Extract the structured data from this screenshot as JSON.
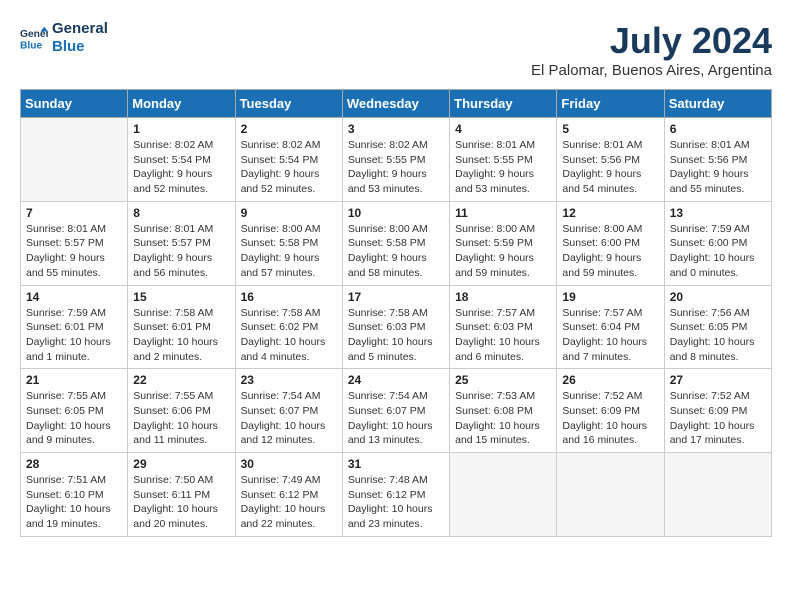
{
  "header": {
    "logo_line1": "General",
    "logo_line2": "Blue",
    "month_title": "July 2024",
    "location": "El Palomar, Buenos Aires, Argentina"
  },
  "calendar": {
    "days_of_week": [
      "Sunday",
      "Monday",
      "Tuesday",
      "Wednesday",
      "Thursday",
      "Friday",
      "Saturday"
    ],
    "weeks": [
      [
        {
          "day": "",
          "info": ""
        },
        {
          "day": "1",
          "info": "Sunrise: 8:02 AM\nSunset: 5:54 PM\nDaylight: 9 hours\nand 52 minutes."
        },
        {
          "day": "2",
          "info": "Sunrise: 8:02 AM\nSunset: 5:54 PM\nDaylight: 9 hours\nand 52 minutes."
        },
        {
          "day": "3",
          "info": "Sunrise: 8:02 AM\nSunset: 5:55 PM\nDaylight: 9 hours\nand 53 minutes."
        },
        {
          "day": "4",
          "info": "Sunrise: 8:01 AM\nSunset: 5:55 PM\nDaylight: 9 hours\nand 53 minutes."
        },
        {
          "day": "5",
          "info": "Sunrise: 8:01 AM\nSunset: 5:56 PM\nDaylight: 9 hours\nand 54 minutes."
        },
        {
          "day": "6",
          "info": "Sunrise: 8:01 AM\nSunset: 5:56 PM\nDaylight: 9 hours\nand 55 minutes."
        }
      ],
      [
        {
          "day": "7",
          "info": "Sunrise: 8:01 AM\nSunset: 5:57 PM\nDaylight: 9 hours\nand 55 minutes."
        },
        {
          "day": "8",
          "info": "Sunrise: 8:01 AM\nSunset: 5:57 PM\nDaylight: 9 hours\nand 56 minutes."
        },
        {
          "day": "9",
          "info": "Sunrise: 8:00 AM\nSunset: 5:58 PM\nDaylight: 9 hours\nand 57 minutes."
        },
        {
          "day": "10",
          "info": "Sunrise: 8:00 AM\nSunset: 5:58 PM\nDaylight: 9 hours\nand 58 minutes."
        },
        {
          "day": "11",
          "info": "Sunrise: 8:00 AM\nSunset: 5:59 PM\nDaylight: 9 hours\nand 59 minutes."
        },
        {
          "day": "12",
          "info": "Sunrise: 8:00 AM\nSunset: 6:00 PM\nDaylight: 9 hours\nand 59 minutes."
        },
        {
          "day": "13",
          "info": "Sunrise: 7:59 AM\nSunset: 6:00 PM\nDaylight: 10 hours\nand 0 minutes."
        }
      ],
      [
        {
          "day": "14",
          "info": "Sunrise: 7:59 AM\nSunset: 6:01 PM\nDaylight: 10 hours\nand 1 minute."
        },
        {
          "day": "15",
          "info": "Sunrise: 7:58 AM\nSunset: 6:01 PM\nDaylight: 10 hours\nand 2 minutes."
        },
        {
          "day": "16",
          "info": "Sunrise: 7:58 AM\nSunset: 6:02 PM\nDaylight: 10 hours\nand 4 minutes."
        },
        {
          "day": "17",
          "info": "Sunrise: 7:58 AM\nSunset: 6:03 PM\nDaylight: 10 hours\nand 5 minutes."
        },
        {
          "day": "18",
          "info": "Sunrise: 7:57 AM\nSunset: 6:03 PM\nDaylight: 10 hours\nand 6 minutes."
        },
        {
          "day": "19",
          "info": "Sunrise: 7:57 AM\nSunset: 6:04 PM\nDaylight: 10 hours\nand 7 minutes."
        },
        {
          "day": "20",
          "info": "Sunrise: 7:56 AM\nSunset: 6:05 PM\nDaylight: 10 hours\nand 8 minutes."
        }
      ],
      [
        {
          "day": "21",
          "info": "Sunrise: 7:55 AM\nSunset: 6:05 PM\nDaylight: 10 hours\nand 9 minutes."
        },
        {
          "day": "22",
          "info": "Sunrise: 7:55 AM\nSunset: 6:06 PM\nDaylight: 10 hours\nand 11 minutes."
        },
        {
          "day": "23",
          "info": "Sunrise: 7:54 AM\nSunset: 6:07 PM\nDaylight: 10 hours\nand 12 minutes."
        },
        {
          "day": "24",
          "info": "Sunrise: 7:54 AM\nSunset: 6:07 PM\nDaylight: 10 hours\nand 13 minutes."
        },
        {
          "day": "25",
          "info": "Sunrise: 7:53 AM\nSunset: 6:08 PM\nDaylight: 10 hours\nand 15 minutes."
        },
        {
          "day": "26",
          "info": "Sunrise: 7:52 AM\nSunset: 6:09 PM\nDaylight: 10 hours\nand 16 minutes."
        },
        {
          "day": "27",
          "info": "Sunrise: 7:52 AM\nSunset: 6:09 PM\nDaylight: 10 hours\nand 17 minutes."
        }
      ],
      [
        {
          "day": "28",
          "info": "Sunrise: 7:51 AM\nSunset: 6:10 PM\nDaylight: 10 hours\nand 19 minutes."
        },
        {
          "day": "29",
          "info": "Sunrise: 7:50 AM\nSunset: 6:11 PM\nDaylight: 10 hours\nand 20 minutes."
        },
        {
          "day": "30",
          "info": "Sunrise: 7:49 AM\nSunset: 6:12 PM\nDaylight: 10 hours\nand 22 minutes."
        },
        {
          "day": "31",
          "info": "Sunrise: 7:48 AM\nSunset: 6:12 PM\nDaylight: 10 hours\nand 23 minutes."
        },
        {
          "day": "",
          "info": ""
        },
        {
          "day": "",
          "info": ""
        },
        {
          "day": "",
          "info": ""
        }
      ]
    ]
  }
}
